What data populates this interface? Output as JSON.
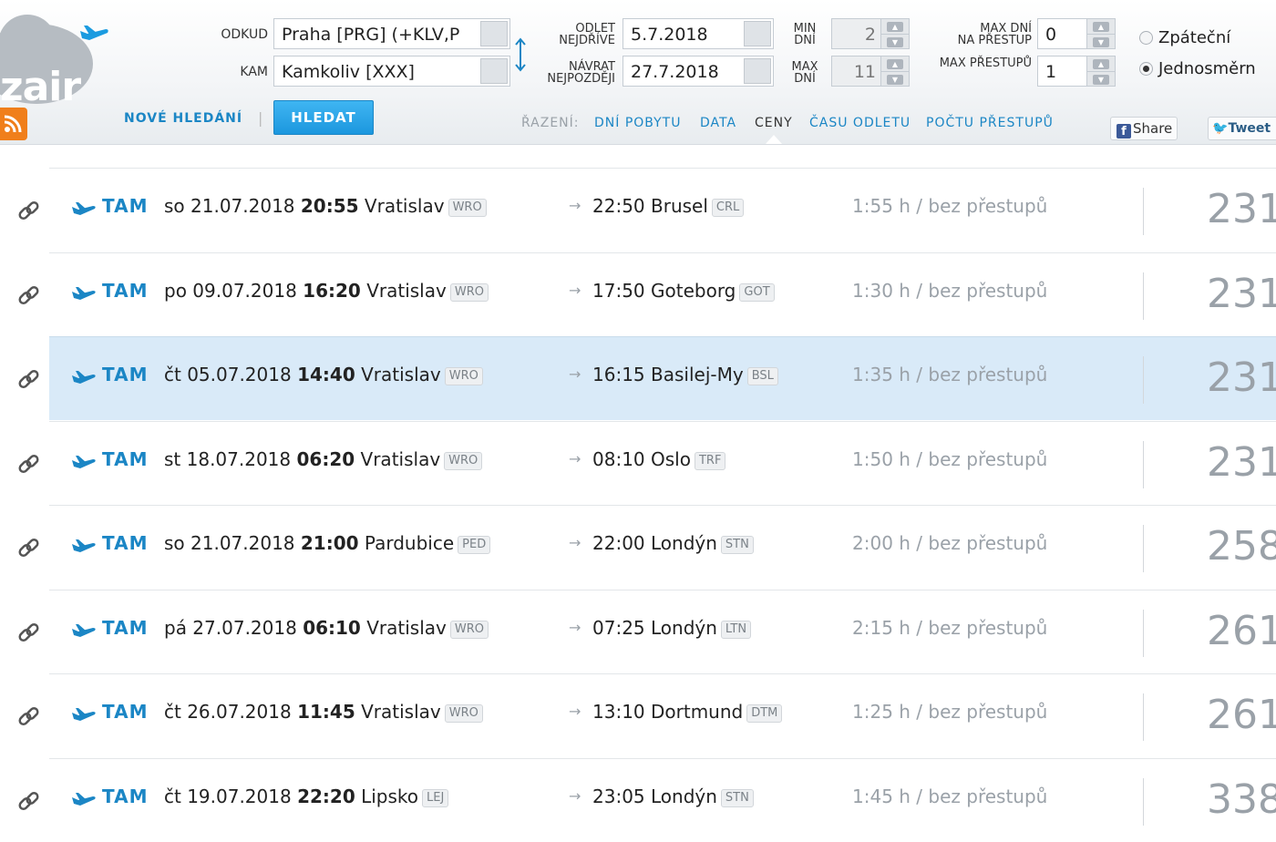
{
  "brand": {
    "logo_text": "zair",
    "logo_icon": "cloud-plane-icon",
    "rss_icon": "rss-icon"
  },
  "search": {
    "from_label": "ODKUD",
    "from_value": "Praha [PRG] (+KLV,P",
    "to_label": "KAM",
    "to_value": "Kamkoliv [XXX]",
    "swap_icon": "swap-arrows-icon",
    "depart_label_1": "ODLET",
    "depart_label_2": "NEJDŘÍVE",
    "depart_value": "5.7.2018",
    "return_label_1": "NÁVRAT",
    "return_label_2": "NEJPOZDĚJI",
    "return_value": "27.7.2018",
    "min_days_label_1": "MIN",
    "min_days_label_2": "DNÍ",
    "min_days_value": "2",
    "max_days_label_1": "MAX",
    "max_days_label_2": "DNÍ",
    "max_days_value": "11",
    "max_days_stop_label_1": "MAX DNÍ",
    "max_days_stop_label_2": "NA PŘESTUP",
    "max_days_stop_value": "0",
    "max_transfers_label": "MAX PŘESTUPŮ",
    "max_transfers_value": "1",
    "trip_return": "Zpáteční",
    "trip_oneway": "Jednosměrn",
    "selected_trip": "oneway",
    "new_search": "NOVÉ HLEDÁNÍ",
    "search_button": "HLEDAT"
  },
  "sort": {
    "label": "ŘAZENÍ:",
    "options": [
      "DNÍ POBYTU",
      "DATA",
      "CENY",
      "ČASU ODLETU",
      "POČTU PŘESTUPŮ"
    ],
    "active": "CENY"
  },
  "social": {
    "share": "Share",
    "tweet": "Tweet"
  },
  "colors": {
    "accent": "#1b86c5",
    "highlight_row": "#d9eaf8",
    "muted": "#9aa1a8"
  },
  "results": [
    {
      "dir": "TAM",
      "day": "so 21.07.2018",
      "dep_time": "20:55",
      "from": "Vratislav",
      "from_code": "WRO",
      "arr_time": "22:50",
      "to": "Brusel",
      "to_code": "CRL",
      "duration": "1:55 h / bez přestupů",
      "price": "231",
      "highlighted": false
    },
    {
      "dir": "TAM",
      "day": "po 09.07.2018",
      "dep_time": "16:20",
      "from": "Vratislav",
      "from_code": "WRO",
      "arr_time": "17:50",
      "to": "Goteborg",
      "to_code": "GOT",
      "duration": "1:30 h / bez přestupů",
      "price": "231",
      "highlighted": false
    },
    {
      "dir": "TAM",
      "day": "čt 05.07.2018",
      "dep_time": "14:40",
      "from": "Vratislav",
      "from_code": "WRO",
      "arr_time": "16:15",
      "to": "Basilej-My",
      "to_code": "BSL",
      "duration": "1:35 h / bez přestupů",
      "price": "231",
      "highlighted": true
    },
    {
      "dir": "TAM",
      "day": "st 18.07.2018",
      "dep_time": "06:20",
      "from": "Vratislav",
      "from_code": "WRO",
      "arr_time": "08:10",
      "to": "Oslo",
      "to_code": "TRF",
      "duration": "1:50 h / bez přestupů",
      "price": "231",
      "highlighted": false
    },
    {
      "dir": "TAM",
      "day": "so 21.07.2018",
      "dep_time": "21:00",
      "from": "Pardubice",
      "from_code": "PED",
      "arr_time": "22:00",
      "to": "Londýn",
      "to_code": "STN",
      "duration": "2:00 h / bez přestupů",
      "price": "258",
      "highlighted": false
    },
    {
      "dir": "TAM",
      "day": "pá 27.07.2018",
      "dep_time": "06:10",
      "from": "Vratislav",
      "from_code": "WRO",
      "arr_time": "07:25",
      "to": "Londýn",
      "to_code": "LTN",
      "duration": "2:15 h / bez přestupů",
      "price": "261",
      "highlighted": false
    },
    {
      "dir": "TAM",
      "day": "čt 26.07.2018",
      "dep_time": "11:45",
      "from": "Vratislav",
      "from_code": "WRO",
      "arr_time": "13:10",
      "to": "Dortmund",
      "to_code": "DTM",
      "duration": "1:25 h / bez přestupů",
      "price": "261",
      "highlighted": false
    },
    {
      "dir": "TAM",
      "day": "čt 19.07.2018",
      "dep_time": "22:20",
      "from": "Lipsko",
      "from_code": "LEJ",
      "arr_time": "23:05",
      "to": "Londýn",
      "to_code": "STN",
      "duration": "1:45 h / bez přestupů",
      "price": "338",
      "highlighted": false
    }
  ]
}
